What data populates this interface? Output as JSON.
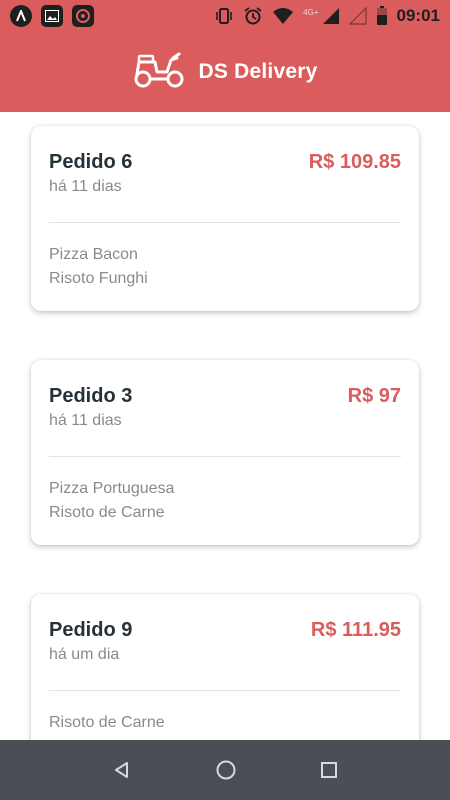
{
  "status_bar": {
    "time": "09:01",
    "network": "4G+",
    "icons": [
      "app-a-icon",
      "image-icon",
      "app-badge-icon",
      "vibrate-icon",
      "alarm-icon",
      "wifi-icon",
      "signal-icon",
      "signal-empty-icon",
      "battery-icon"
    ]
  },
  "app_bar": {
    "title": "DS Delivery",
    "logo_icon": "scooter-icon"
  },
  "orders": [
    {
      "title": "Pedido 6",
      "price": "R$ 109.85",
      "date": "há 11 dias",
      "items": [
        "Pizza Bacon",
        "Risoto Funghi"
      ]
    },
    {
      "title": "Pedido 3",
      "price": "R$ 97",
      "date": "há 11 dias",
      "items": [
        "Pizza Portuguesa",
        "Risoto de Carne"
      ]
    },
    {
      "title": "Pedido 9",
      "price": "R$ 111.95",
      "date": "há um dia",
      "items": [
        "Risoto de Carne"
      ]
    }
  ],
  "nav_bar": {
    "icons": [
      "back-icon",
      "home-icon",
      "recents-icon"
    ]
  },
  "colors": {
    "primary": "#DA5C5C",
    "title_text": "#263238",
    "muted_text": "#8a8a8a",
    "navbar": "#4a4f55"
  }
}
